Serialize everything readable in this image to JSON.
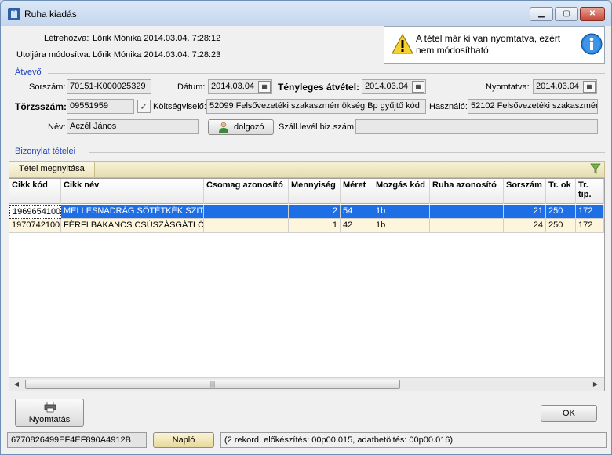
{
  "window": {
    "title": "Ruha kiadás"
  },
  "header": {
    "created_label": "Létrehozva:",
    "created_value": "Lőrik Mónika 2014.03.04. 7:28:12",
    "modified_label": "Utoljára módosítva:",
    "modified_value": "Lőrik Mónika 2014.03.04. 7:28:23"
  },
  "message": {
    "text": "A tétel már ki van nyomtatva, ezért nem módosítható."
  },
  "atvevo": {
    "group_title": "Átvevő",
    "sorszam_label": "Sorszám:",
    "sorszam_value": "70151-K000025329",
    "datum_label": "Dátum:",
    "datum_value": "2014.03.04",
    "tenyleges_label": "Tényleges átvétel:",
    "tenyleges_value": "2014.03.04",
    "nyomtatva_label": "Nyomtatva:",
    "nyomtatva_value": "2014.03.04",
    "torzsszam_label": "Törzsszám:",
    "torzsszam_value": "09551959",
    "koltseg_label": "Költségviselő:",
    "koltseg_value": "52099 Felsővezetéki szakaszmérnökség Bp gyűjtő kód",
    "hasznalo_label": "Használó:",
    "hasznalo_value": "52102 Felsővezetéki szakaszmérn",
    "nev_label": "Név:",
    "nev_value": "Aczél János",
    "dolgozo_button": "dolgozó",
    "szall_label": "Száll.levél biz.szám:",
    "szall_value": ""
  },
  "items": {
    "group_title": "Bizonylat tételei",
    "open_button": "Tétel megnyitása",
    "columns": [
      "Cikk kód",
      "Cikk név",
      "Csomag azonosító",
      "Mennyiség",
      "Méret",
      "Mozgás kód",
      "Ruha azonosító",
      "Sorszám",
      "Tr. ok",
      "Tr. tip."
    ],
    "rows": [
      [
        "1969654100",
        "MELLESNADRÁG SÖTÉTKÉK SZITÁZO",
        "",
        "2",
        "54",
        "1b",
        "",
        "21",
        "250",
        "172"
      ],
      [
        "1970742100",
        "FÉRFI BAKANCS CSÚSZÁSGÁTLÓ OL",
        "",
        "1",
        "42",
        "1b",
        "",
        "24",
        "250",
        "172"
      ]
    ]
  },
  "footer": {
    "print_button": "Nyomtatás",
    "ok_button": "OK"
  },
  "status": {
    "id": "6770826499EF4EF890A4912B",
    "naplo_button": "Napló",
    "info": "(2 rekord, előkészítés: 00p00.015, adatbetöltés: 00p00.016)"
  },
  "icons": {
    "app": "shirt-icon",
    "warning": "warning-icon",
    "info": "info-icon",
    "calendar": "calendar-icon",
    "person": "person-icon",
    "printer": "printer-icon",
    "filter": "filter-icon"
  },
  "colors": {
    "selection": "#1e6fe6",
    "alt_row": "#fdf6dc",
    "group_title": "#1d3fbf",
    "toolbar": "#ece3ba"
  }
}
